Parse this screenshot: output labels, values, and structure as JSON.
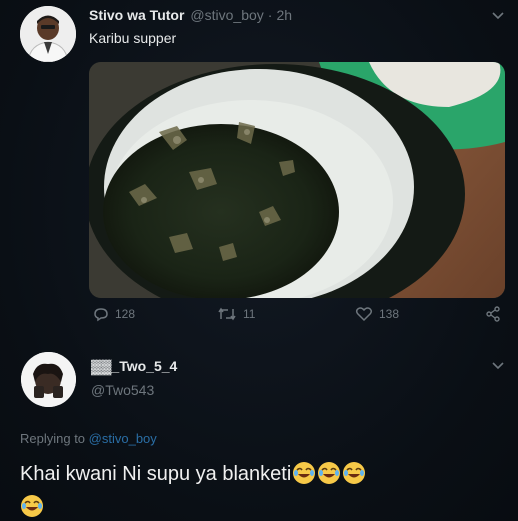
{
  "tweet1": {
    "display_name": "Stivo wa Tutor",
    "handle": "@stivo_boy",
    "time": "2h",
    "text": "Karibu supper",
    "media_alt_icon": "soup-bowl-photo",
    "actions": {
      "reply_count": "128",
      "retweet_count": "11",
      "like_count": "138"
    }
  },
  "tweet2": {
    "display_name": "▓▓_Two_5_4",
    "handle": "@Two543",
    "replying_prefix": "Replying to",
    "replying_handle": "@stivo_boy",
    "text": "Khai kwani Ni supu ya blanketi"
  },
  "colors": {
    "background": "#0c1117",
    "primary_text": "#e7e9ea",
    "secondary_text": "#6e767d",
    "link": "#2a6ea5"
  },
  "icons": [
    "chevron-down-icon",
    "reply-icon",
    "retweet-icon",
    "like-icon",
    "share-icon",
    "joy-emoji-icon"
  ]
}
